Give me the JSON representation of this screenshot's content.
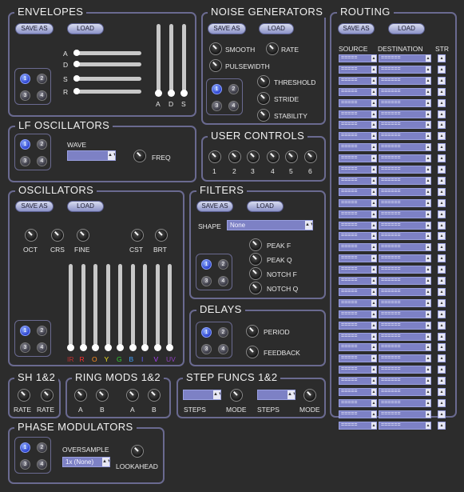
{
  "common": {
    "save_as": "SAVE AS",
    "load": "LOAD"
  },
  "envelopes": {
    "title": "ENVELOPES",
    "slider_labels": [
      "A",
      "D",
      "S",
      "R"
    ],
    "vslider_labels": [
      "A",
      "D",
      "S"
    ],
    "grid": [
      "1",
      "2",
      "3",
      "4"
    ]
  },
  "noise": {
    "title": "NOISE GENERATORS",
    "knobs": [
      "SMOOTH",
      "RATE",
      "PULSEWIDTH",
      "THRESHOLD",
      "STRIDE",
      "STABILITY"
    ],
    "grid": [
      "1",
      "2",
      "3",
      "4"
    ]
  },
  "routing": {
    "title": "ROUTING",
    "headers": [
      "SOURCE",
      "DESTINATION",
      "STR"
    ],
    "source_value": "=====",
    "destination_value": "======",
    "row_count": 34
  },
  "lfo": {
    "title": "LF OSCILLATORS",
    "wave_label": "WAVE",
    "freq_label": "FREQ",
    "grid": [
      "1",
      "2",
      "3",
      "4"
    ]
  },
  "user_controls": {
    "title": "USER CONTROLS",
    "knobs": [
      "1",
      "2",
      "3",
      "4",
      "5",
      "6"
    ]
  },
  "oscillators": {
    "title": "OSCILLATORS",
    "knobs": [
      "OCT",
      "CRS",
      "FINE",
      "CST",
      "BRT"
    ],
    "color_labels": [
      "IR",
      "R",
      "O",
      "Y",
      "G",
      "B",
      "I",
      "V",
      "UV"
    ],
    "colors": [
      "#c03030",
      "#ff3030",
      "#ff9020",
      "#f0e020",
      "#30d030",
      "#40a0ff",
      "#6060ff",
      "#b040ff",
      "#9040c0"
    ],
    "grid": [
      "1",
      "2",
      "3",
      "4"
    ]
  },
  "filters": {
    "title": "FILTERS",
    "shape_label": "SHAPE",
    "shape_value": "None",
    "knobs": [
      "PEAK F",
      "PEAK Q",
      "NOTCH F",
      "NOTCH Q"
    ],
    "grid": [
      "1",
      "2",
      "3",
      "4"
    ]
  },
  "delays": {
    "title": "DELAYS",
    "knobs": [
      "PERIOD",
      "FEEDBACK"
    ],
    "grid": [
      "1",
      "2",
      "3",
      "4"
    ]
  },
  "sh": {
    "title": "SH 1&2",
    "knobs": [
      "RATE",
      "RATE"
    ]
  },
  "ring_mods": {
    "title": "RING MODS 1&2",
    "knobs": [
      "A",
      "B",
      "A",
      "B"
    ]
  },
  "step_funcs": {
    "title": "STEP FUNCS 1&2",
    "labels": [
      "STEPS",
      "MODE",
      "STEPS",
      "MODE"
    ]
  },
  "phase_mod": {
    "title": "PHASE MODULATORS",
    "oversample_label": "OVERSAMPLE",
    "oversample_value": "1x (None)",
    "lookahead_label": "LOOKAHEAD",
    "grid": [
      "1",
      "2",
      "3",
      "4"
    ]
  }
}
